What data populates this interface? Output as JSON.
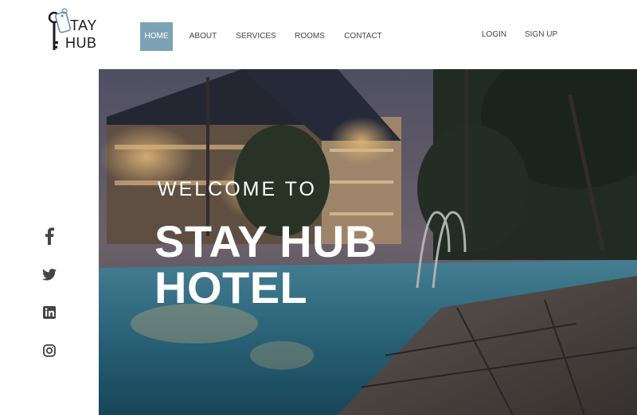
{
  "brand": {
    "line1": "TAY",
    "line2": "HUB"
  },
  "nav": {
    "items": [
      {
        "label": "HOME",
        "active": true
      },
      {
        "label": "ABOUT",
        "active": false
      },
      {
        "label": "SERVICES",
        "active": false
      },
      {
        "label": "ROOMS",
        "active": false
      },
      {
        "label": "CONTACT",
        "active": false
      }
    ]
  },
  "auth": {
    "login": "LOGIN",
    "signup": "SIGN UP"
  },
  "social": [
    "facebook-icon",
    "twitter-icon",
    "linkedin-icon",
    "instagram-icon"
  ],
  "hero": {
    "welcome": "WELCOME TO",
    "title_line1": "STAY HUB",
    "title_line2": "HOTEL"
  },
  "colors": {
    "accent": "#7ea2b5",
    "icon": "#444444"
  }
}
